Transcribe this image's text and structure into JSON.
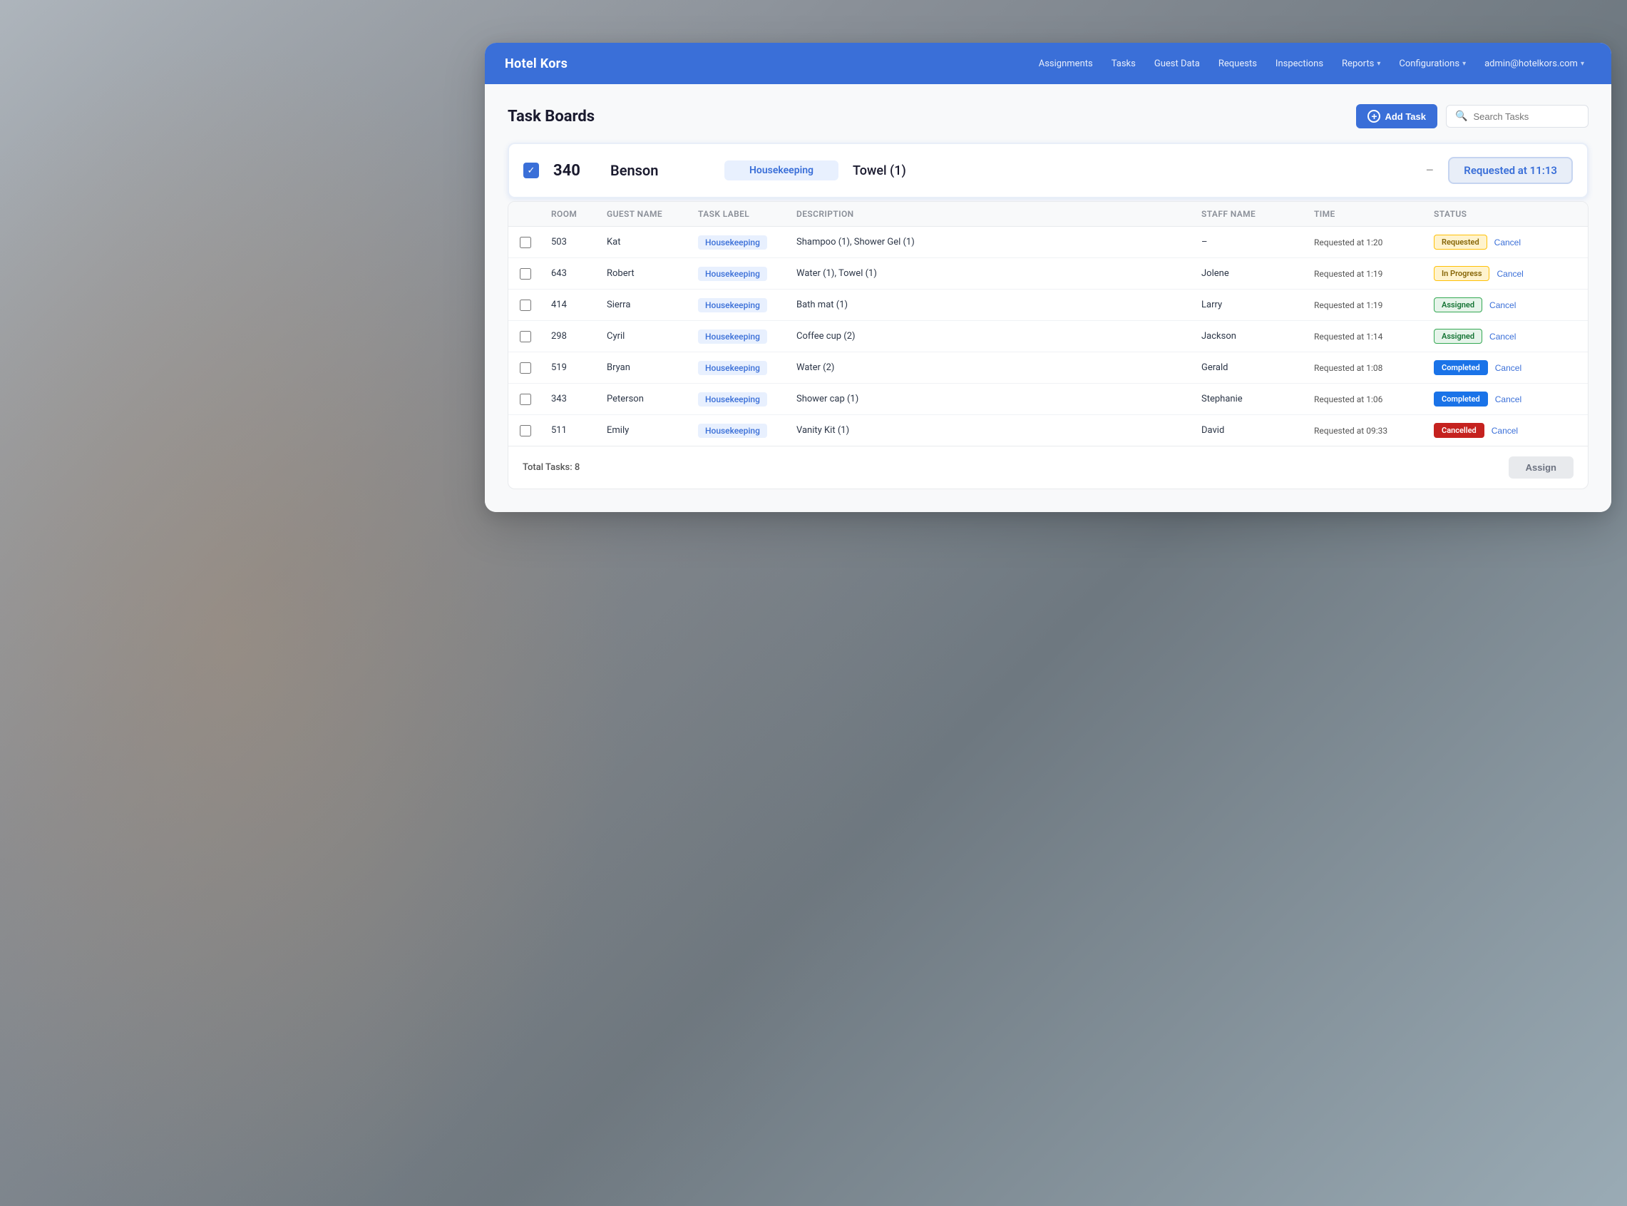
{
  "brand": "Hotel Kors",
  "navbar": {
    "items": [
      {
        "label": "Assignments",
        "hasChevron": false
      },
      {
        "label": "Tasks",
        "hasChevron": false
      },
      {
        "label": "Guest Data",
        "hasChevron": false
      },
      {
        "label": "Requests",
        "hasChevron": false
      },
      {
        "label": "Inspections",
        "hasChevron": false
      },
      {
        "label": "Reports",
        "hasChevron": true
      },
      {
        "label": "Configurations",
        "hasChevron": true
      },
      {
        "label": "admin@hotelkors.com",
        "hasChevron": true
      }
    ]
  },
  "page": {
    "title": "Task Boards",
    "add_task_label": "Add Task",
    "search_placeholder": "Search Tasks"
  },
  "featured_row": {
    "room": "340",
    "guest": "Benson",
    "label": "Housekeeping",
    "description": "Towel (1)",
    "staff": "–",
    "time": "Requested at 11:13",
    "status": "Requested at 11:13"
  },
  "table": {
    "columns": [
      "",
      "Room",
      "Guest Name",
      "Task Label",
      "Description",
      "Staff Name",
      "Time",
      "Status"
    ],
    "rows": [
      {
        "room": "503",
        "guest": "Kat",
        "label": "Housekeeping",
        "description": "Shampoo (1), Shower Gel (1)",
        "staff": "–",
        "time": "Requested at 1:20",
        "status": "Requested",
        "status_type": "requested"
      },
      {
        "room": "643",
        "guest": "Robert",
        "label": "Housekeeping",
        "description": "Water (1), Towel (1)",
        "staff": "Jolene",
        "time": "Requested at 1:19",
        "status": "In Progress",
        "status_type": "in_progress"
      },
      {
        "room": "414",
        "guest": "Sierra",
        "label": "Housekeeping",
        "description": "Bath mat (1)",
        "staff": "Larry",
        "time": "Requested at 1:19",
        "status": "Assigned",
        "status_type": "assigned"
      },
      {
        "room": "298",
        "guest": "Cyril",
        "label": "Housekeeping",
        "description": "Coffee cup (2)",
        "staff": "Jackson",
        "time": "Requested at 1:14",
        "status": "Assigned",
        "status_type": "assigned"
      },
      {
        "room": "519",
        "guest": "Bryan",
        "label": "Housekeeping",
        "description": "Water (2)",
        "staff": "Gerald",
        "time": "Requested at 1:08",
        "status": "Completed",
        "status_type": "completed"
      },
      {
        "room": "343",
        "guest": "Peterson",
        "label": "Housekeeping",
        "description": "Shower cap (1)",
        "staff": "Stephanie",
        "time": "Requested at 1:06",
        "status": "Completed",
        "status_type": "completed"
      },
      {
        "room": "511",
        "guest": "Emily",
        "label": "Housekeeping",
        "description": "Vanity Kit (1)",
        "staff": "David",
        "time": "Requested at 09:33",
        "status": "Cancelled",
        "status_type": "cancelled"
      }
    ]
  },
  "footer": {
    "total_label": "Total Tasks: 8",
    "assign_label": "Assign"
  },
  "cancel_label": "Cancel"
}
